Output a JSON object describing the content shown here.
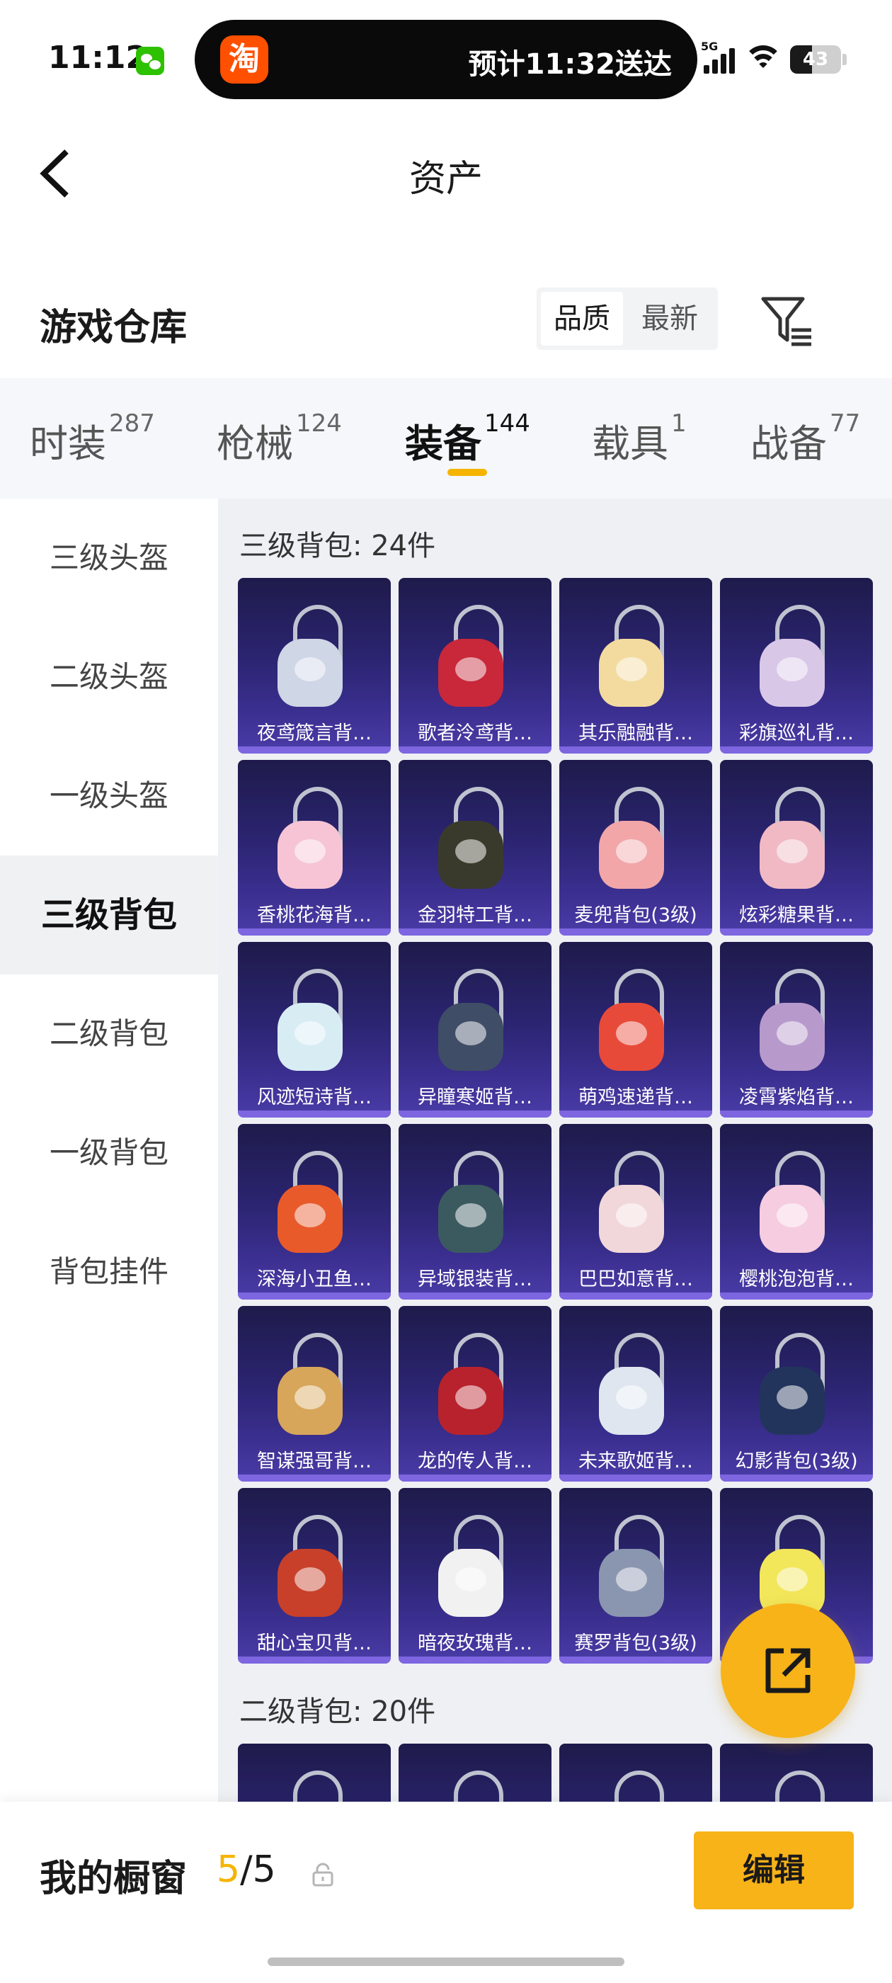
{
  "status_bar": {
    "time": "11:12",
    "island_text": "预计11:32送达",
    "taobao_glyph": "淘",
    "network": "5G",
    "battery": "43",
    "battery_level": 0.43
  },
  "header": {
    "title": "资产"
  },
  "section": {
    "title": "游戏仓库",
    "sort_options": [
      "品质",
      "最新"
    ],
    "active_sort": "品质"
  },
  "tabs": [
    {
      "label": "时装",
      "count": "287",
      "active": false
    },
    {
      "label": "枪械",
      "count": "124",
      "active": false
    },
    {
      "label": "装备",
      "count": "144",
      "active": true
    },
    {
      "label": "载具",
      "count": "1",
      "active": false
    },
    {
      "label": "战备",
      "count": "77",
      "active": false
    }
  ],
  "sidebar": {
    "items": [
      {
        "label": "三级头盔",
        "active": false
      },
      {
        "label": "二级头盔",
        "active": false
      },
      {
        "label": "一级头盔",
        "active": false
      },
      {
        "label": "三级背包",
        "active": true
      },
      {
        "label": "二级背包",
        "active": false
      },
      {
        "label": "一级背包",
        "active": false
      },
      {
        "label": "背包挂件",
        "active": false
      }
    ]
  },
  "groups": [
    {
      "title": "三级背包: 24件",
      "items": [
        {
          "name": "夜鸢箴言背…",
          "color": "#cfd6e6"
        },
        {
          "name": "歌者泠鸢背…",
          "color": "#c8283a"
        },
        {
          "name": "其乐融融背…",
          "color": "#f3dba0"
        },
        {
          "name": "彩旗巡礼背…",
          "color": "#d9c7e8"
        },
        {
          "name": "香桃花海背…",
          "color": "#f6c4d4"
        },
        {
          "name": "金羽特工背…",
          "color": "#3a3a2c"
        },
        {
          "name": "麦兜背包(3级)",
          "color": "#f2a6a8"
        },
        {
          "name": "炫彩糖果背…",
          "color": "#f0b9c4"
        },
        {
          "name": "风迹短诗背…",
          "color": "#d8ecf4"
        },
        {
          "name": "异瞳寒姬背…",
          "color": "#3f4d66"
        },
        {
          "name": "萌鸡速递背…",
          "color": "#e84a3a"
        },
        {
          "name": "凌霄紫焰背…",
          "color": "#b79acb"
        },
        {
          "name": "深海小丑鱼…",
          "color": "#e85a2a"
        },
        {
          "name": "异域银装背…",
          "color": "#3b5a60"
        },
        {
          "name": "巴巴如意背…",
          "color": "#f2d7da"
        },
        {
          "name": "樱桃泡泡背…",
          "color": "#f5cce0"
        },
        {
          "name": "智谋强哥背…",
          "color": "#d8a65a"
        },
        {
          "name": "龙的传人背…",
          "color": "#b8222c"
        },
        {
          "name": "未来歌姬背…",
          "color": "#dfe6f0"
        },
        {
          "name": "幻影背包(3级)",
          "color": "#22345c"
        },
        {
          "name": "甜心宝贝背…",
          "color": "#c8402a"
        },
        {
          "name": "暗夜玫瑰背…",
          "color": "#f1f1f1"
        },
        {
          "name": "赛罗背包(3级)",
          "color": "#8a96b0"
        },
        {
          "name": "",
          "color": "#f2e65a"
        }
      ]
    },
    {
      "title": "二级背包: 20件",
      "items": [
        {
          "name": "",
          "color": "#cfd6e6"
        },
        {
          "name": "",
          "color": "#3f4d66"
        },
        {
          "name": "",
          "color": "#f2a6a8"
        },
        {
          "name": "",
          "color": "#f0b9c4"
        }
      ]
    }
  ],
  "bottom_bar": {
    "label": "我的橱窗",
    "count_current": "5",
    "count_sep": "/",
    "count_max": "5",
    "edit_label": "编辑"
  },
  "colors": {
    "accent": "#f7b318",
    "tile_bg": "#2b2470",
    "tile_bottom": "#7d66e0"
  }
}
